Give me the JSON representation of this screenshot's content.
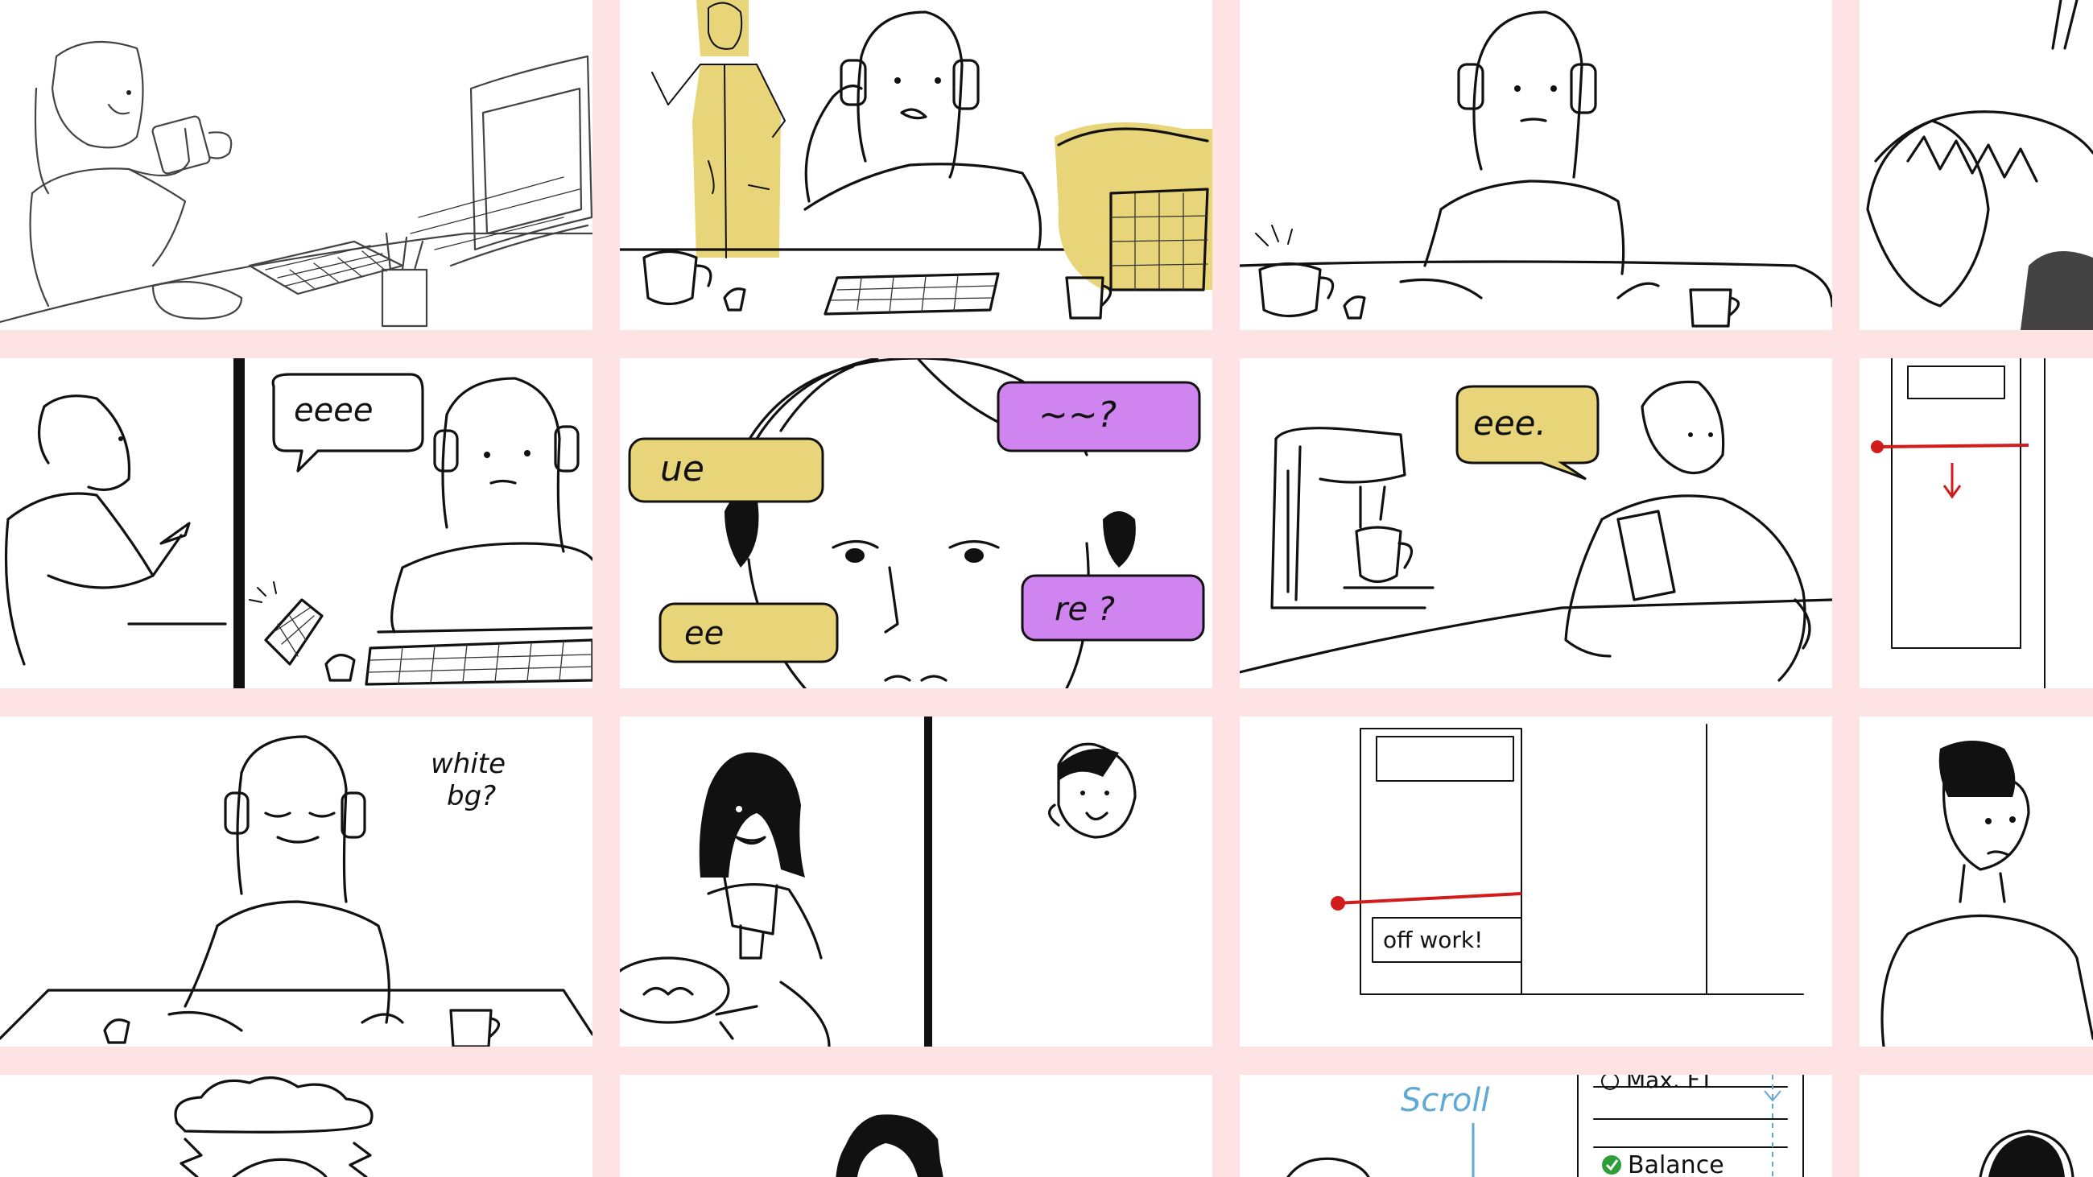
{
  "board": {
    "background": "#fde3e3",
    "panel_color": "#ffffff",
    "accent_yellow": "#e8d579",
    "accent_purple": "#cf84f0",
    "accent_red": "#d21b1b",
    "accent_blue": "#5ea9d6"
  },
  "annotations": {
    "white_bg_line1": "white",
    "white_bg_line2": "bg?",
    "off_work": "off work!",
    "scroll": "Scroll",
    "max_label": "Max. FT",
    "balance_label": "Balance"
  },
  "speech": {
    "left_bubble": "eeee",
    "right_bubble": "eee."
  },
  "bubbles": {
    "yellow_top": "ue",
    "yellow_bottom": "ee",
    "purple_top": "~~?",
    "purple_bottom": "re ?"
  }
}
